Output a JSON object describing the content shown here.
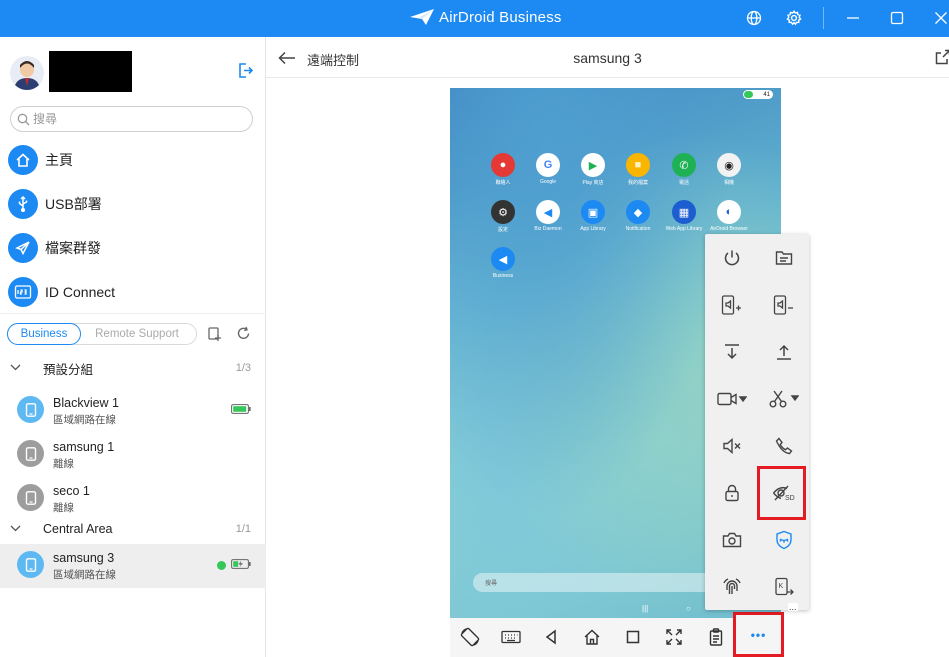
{
  "titlebar": {
    "brand": "AirDroid Business",
    "colors": {
      "bar": "#1c8af2"
    }
  },
  "sidebar": {
    "search_placeholder": "搜尋",
    "nav": [
      {
        "label": "主頁",
        "icon": "home-icon"
      },
      {
        "label": "USB部署",
        "icon": "usb-icon"
      },
      {
        "label": "檔案群發",
        "icon": "send-icon"
      },
      {
        "label": "ID Connect",
        "icon": "id-connect-icon"
      }
    ],
    "tabs": {
      "business": "Business",
      "remote_support": "Remote Support"
    },
    "groups": [
      {
        "name": "預設分組",
        "count": "1/3",
        "devices": [
          {
            "name": "Blackview 1",
            "status": "區域網路在線"
          },
          {
            "name": "samsung 1",
            "status": "離線"
          },
          {
            "name": "seco 1",
            "status": "離線"
          }
        ]
      },
      {
        "name": "Central Area",
        "count": "1/1",
        "devices": [
          {
            "name": "samsung 3",
            "status": "區域網路在線"
          }
        ]
      }
    ]
  },
  "main": {
    "back_label": "遠端控制",
    "device_title": "samsung 3"
  },
  "screen": {
    "battery": "41",
    "apps": [
      {
        "label": "聯絡人",
        "glyph": "●",
        "color": "#e53935"
      },
      {
        "label": "Google",
        "glyph": "G",
        "color": "#ffffff"
      },
      {
        "label": "Play 商店",
        "glyph": "▶",
        "color": "#ffffff"
      },
      {
        "label": "我的檔案",
        "glyph": "■",
        "color": "#f9b500"
      },
      {
        "label": "電話",
        "glyph": "✆",
        "color": "#1fb254"
      },
      {
        "label": "相機",
        "glyph": "◉",
        "color": "#f2f2f2"
      },
      {
        "label": "設定",
        "glyph": "⚙",
        "color": "#333333"
      },
      {
        "label": "Biz Daemon",
        "glyph": "◀",
        "color": "#ffffff"
      },
      {
        "label": "App Library",
        "glyph": "▣",
        "color": "#1c8af2"
      },
      {
        "label": "Notification",
        "glyph": "◆",
        "color": "#1c8af2"
      },
      {
        "label": "Web App Library",
        "glyph": "▦",
        "color": "#1c5dcf"
      },
      {
        "label": "AirDroid Browser",
        "glyph": "◐",
        "color": "#ffffff"
      },
      {
        "label": "Business",
        "glyph": "◀",
        "color": "#1c8af2"
      }
    ],
    "search_hint": "搜尋"
  },
  "more_glyph": "•••",
  "panel_corner": "..."
}
